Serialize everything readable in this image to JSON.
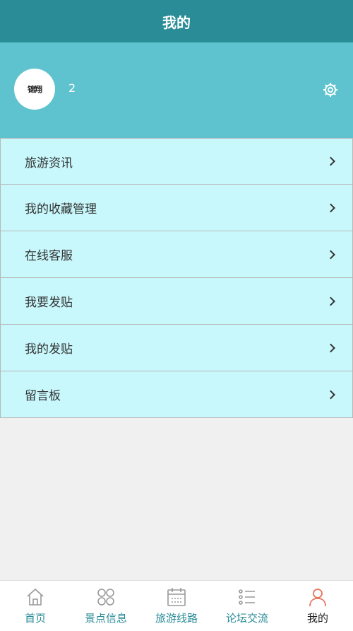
{
  "header": {
    "title": "我的"
  },
  "profile": {
    "avatar_text": "锦翔",
    "username": "2"
  },
  "menu": [
    {
      "label": "旅游资讯"
    },
    {
      "label": "我的收藏管理"
    },
    {
      "label": "在线客服"
    },
    {
      "label": "我要发贴"
    },
    {
      "label": "我的发贴"
    },
    {
      "label": "留言板"
    }
  ],
  "tabbar": {
    "tabs": [
      {
        "label": "首页",
        "icon": "home-icon"
      },
      {
        "label": "景点信息",
        "icon": "clover-icon"
      },
      {
        "label": "旅游线路",
        "icon": "calendar-icon"
      },
      {
        "label": "论坛交流",
        "icon": "list-icon"
      },
      {
        "label": "我的",
        "icon": "user-icon",
        "active": true
      }
    ]
  },
  "colors": {
    "header_bg": "#2a8c96",
    "profile_bg": "#5ec3ce",
    "menu_bg": "#c8f8fc",
    "tab_inactive": "#2a8c96",
    "tab_active_icon": "#e8735a"
  }
}
